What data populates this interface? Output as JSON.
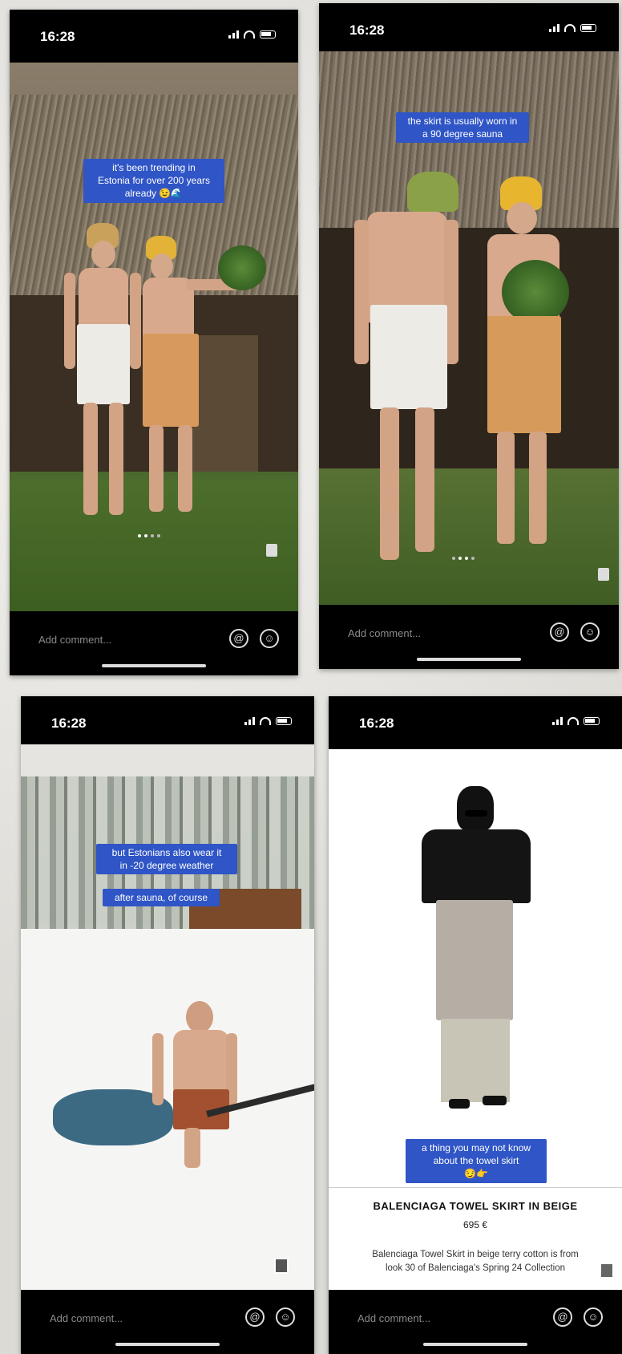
{
  "screens": [
    {
      "status": {
        "time": "16:28"
      },
      "caption": "it's been trending in\nEstonia for over 200 years\nalready 😉🌊",
      "comment_placeholder": "Add comment..."
    },
    {
      "status": {
        "time": "16:28"
      },
      "caption": "the skirt is usually worn in\na 90 degree sauna",
      "comment_placeholder": "Add comment..."
    },
    {
      "status": {
        "time": "16:28"
      },
      "caption": "but Estonians also wear it\nin -20 degree weather",
      "caption2": "after sauna, of course",
      "comment_placeholder": "Add comment..."
    },
    {
      "status": {
        "time": "16:28"
      },
      "caption": "a thing you may not know\nabout the towel skirt\n😏👉",
      "product": {
        "title": "BALENCIAGA TOWEL SKIRT IN BEIGE",
        "price": "695 €",
        "description": "Balenciaga Towel Skirt in beige terry cotton is from\nlook 30 of Balenciaga's Spring 24 Collection"
      },
      "comment_placeholder": "Add comment..."
    }
  ],
  "icons": {
    "mention": "at-sign-icon",
    "emoji": "smiley-icon"
  },
  "colors": {
    "caption_bg": "#2f55c6",
    "bar_bg": "#000000"
  }
}
